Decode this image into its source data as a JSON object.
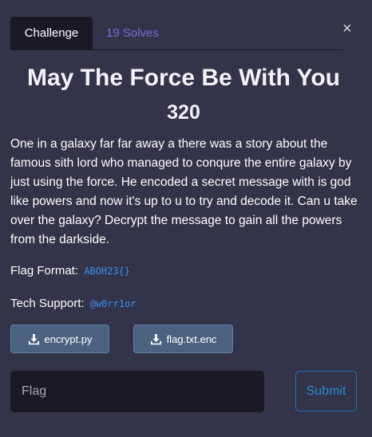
{
  "modal": {
    "close_label": "×",
    "tabs": [
      {
        "label": "Challenge"
      },
      {
        "label": "19 Solves"
      }
    ]
  },
  "challenge": {
    "name": "May The Force Be With You",
    "points": "320",
    "description": "One in a galaxy far far away a there was a story about the famous sith lord who managed to conqure the entire galaxy by just using the force. He encoded a secret message with is god like powers and now it's up to u to try and decode it. Can u take over the galaxy? Decrypt the message to gain all the powers from the darkside.",
    "flag_format_label": "Flag Format:",
    "flag_format_value": "ABOH23{}",
    "tech_support_label": "Tech Support:",
    "tech_support_value": "@w0rr1or"
  },
  "files": [
    {
      "label": "encrypt.py",
      "icon": "download-icon"
    },
    {
      "label": "flag.txt.enc",
      "icon": "download-icon"
    }
  ],
  "submission": {
    "placeholder": "Flag",
    "value": "",
    "submit_label": "Submit"
  },
  "colors": {
    "background": "#333349",
    "tab_active_bg": "#191a23",
    "solves_link": "#7c6dd8",
    "code_text": "#3d8ff0",
    "file_button": "#4a6280",
    "submit_border": "#1d78b4"
  }
}
